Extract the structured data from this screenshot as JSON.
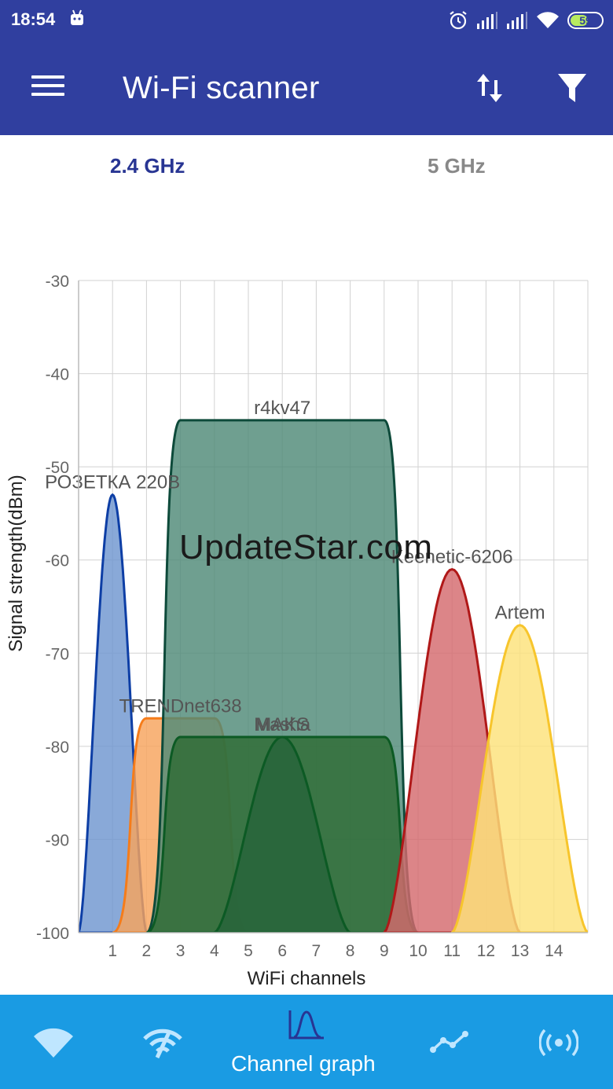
{
  "status_bar": {
    "time": "18:54",
    "battery_level": "59",
    "battery_fraction": 0.59,
    "icons": [
      "android-icon",
      "alarm-icon",
      "signal-icon",
      "signal-icon",
      "wifi-icon",
      "battery-icon"
    ]
  },
  "app_bar": {
    "title": "Wi-Fi scanner",
    "icons": [
      "menu-icon",
      "sort-icon",
      "filter-icon"
    ]
  },
  "tabs": [
    {
      "label": "2.4 GHz",
      "selected": true
    },
    {
      "label": "5 GHz",
      "selected": false
    }
  ],
  "watermark": "UpdateStar.com",
  "bottom_nav": {
    "active_label": "Channel graph",
    "items": [
      "wifi-icon",
      "wifi-rating-icon",
      "channel-graph-icon",
      "time-graph-icon",
      "access-point-icon"
    ]
  },
  "colors": {
    "primary": "#303f9f",
    "selected_tab": "#283593",
    "bottom_nav": "#1a9be3"
  },
  "chart_data": {
    "type": "area",
    "xlabel": "WiFi channels",
    "ylabel": "Signal strength(dBm)",
    "xlim": [
      0,
      15
    ],
    "ylim": [
      -100,
      -30
    ],
    "x_ticks": [
      1,
      2,
      3,
      4,
      5,
      6,
      7,
      8,
      9,
      10,
      11,
      12,
      13,
      14
    ],
    "y_ticks": [
      -30,
      -40,
      -50,
      -60,
      -70,
      -80,
      -90,
      -100
    ],
    "grid": true,
    "series": [
      {
        "name": "РОЗЕТКА 220В",
        "shape": "bell",
        "center": 1,
        "width": 2,
        "signal": -53,
        "color": "#0d3ea5",
        "fill": "#6f96cf"
      },
      {
        "name": "TRENDnet638",
        "shape": "flat",
        "center": 3,
        "width": 4,
        "signal": -77,
        "color": "#f57c1a",
        "fill": "#f7a45d"
      },
      {
        "name": "r4kv47",
        "shape": "flat",
        "center": 6,
        "width": 8,
        "signal": -45,
        "color": "#0d4a3a",
        "fill": "#4f8a78"
      },
      {
        "name": "MAKS",
        "shape": "flat",
        "center": 6,
        "width": 8,
        "signal": -79,
        "color": "#0c5a24",
        "fill": "#2e6b35"
      },
      {
        "name": "Masha",
        "shape": "bell",
        "center": 6,
        "width": 4,
        "signal": -79,
        "color": "#0c5a24",
        "fill": "#27643a"
      },
      {
        "name": "Keenetic-6206",
        "shape": "bell",
        "center": 11,
        "width": 4,
        "signal": -61,
        "color": "#b01818",
        "fill": "#d46a6e"
      },
      {
        "name": "Artem",
        "shape": "bell",
        "center": 13,
        "width": 4,
        "signal": -67,
        "color": "#f7c52c",
        "fill": "#fde27a"
      }
    ]
  }
}
